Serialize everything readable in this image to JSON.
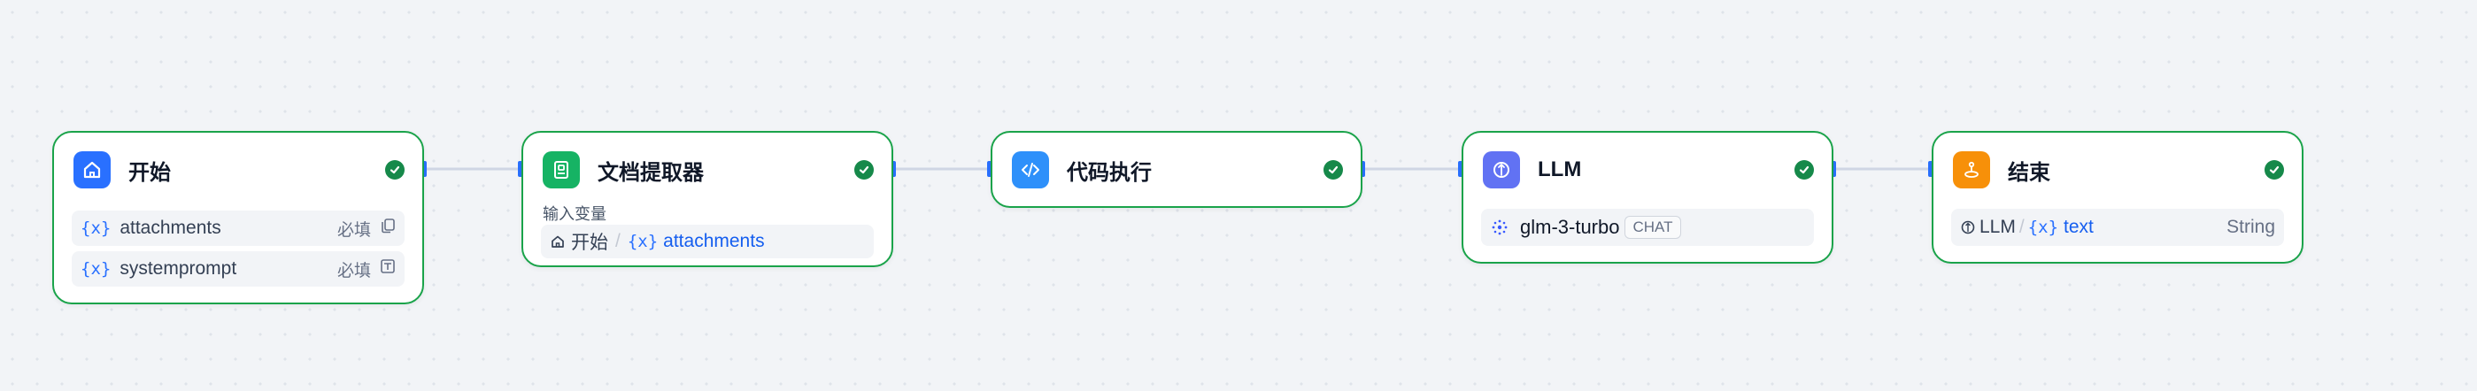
{
  "colors": {
    "success_border": "#1aa34a",
    "edge": "#cfd6e4",
    "port": "#2970ff",
    "var_blue": "#155eef"
  },
  "nodes": {
    "start": {
      "title": "开始",
      "icon": "home-icon",
      "variables": [
        {
          "glyph": "{x}",
          "name": "attachments",
          "required": "必填",
          "type_icon": "files-icon"
        },
        {
          "glyph": "{x}",
          "name": "systemprompt",
          "required": "必填",
          "type_icon": "text-input-icon"
        }
      ]
    },
    "doc_extractor": {
      "title": "文档提取器",
      "icon": "document-icon",
      "input_label": "输入变量",
      "input": {
        "source": "开始",
        "separator": "/",
        "glyph": "{x}",
        "var": "attachments"
      }
    },
    "code": {
      "title": "代码执行",
      "icon": "code-icon"
    },
    "llm": {
      "title": "LLM",
      "icon": "llm-icon",
      "model": "glm-3-turbo",
      "mode": "CHAT"
    },
    "end": {
      "title": "结束",
      "icon": "end-icon",
      "output": {
        "source": "LLM",
        "separator": "/",
        "glyph": "{x}",
        "var": "text",
        "type": "String"
      }
    }
  }
}
